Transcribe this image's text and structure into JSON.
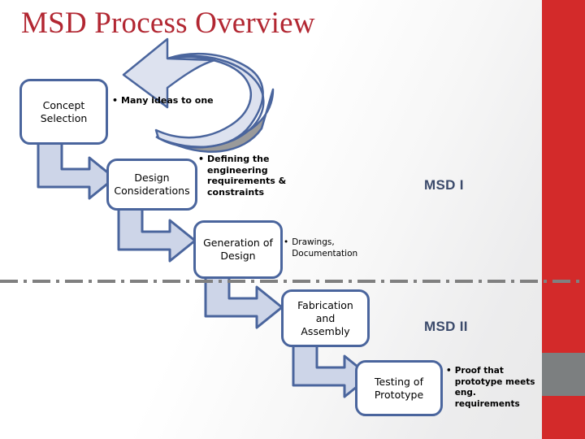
{
  "slide": {
    "title": "MSD Process Overview",
    "title_color": "#b22732",
    "accent_color": "#4a659d",
    "bar_red": "#d32a2a",
    "bar_gray": "#7c7f80"
  },
  "process": {
    "boxes": [
      {
        "id": "concept",
        "label": "Concept\nSelection"
      },
      {
        "id": "design",
        "label": "Design\nConsiderations"
      },
      {
        "id": "generation",
        "label": "Generation of\nDesign"
      },
      {
        "id": "fabrication",
        "label": "Fabrication\nand Assembly"
      },
      {
        "id": "testing",
        "label": "Testing of\nPrototype"
      }
    ],
    "box_labels": {
      "concept_line1": "Concept",
      "concept_line2": "Selection",
      "design_line1": "Design",
      "design_line2": "Considerations",
      "generation_line1": "Generation of",
      "generation_line2": "Design",
      "fabrication_line1": "Fabrication",
      "fabrication_line2": "and Assembly",
      "testing_line1": "Testing of",
      "testing_line2": "Prototype"
    }
  },
  "bullets": {
    "marker": "•",
    "ideas": "Many ideas to one",
    "defining": "Defining the engineering requirements & constraints",
    "drawings": "Drawings, Documentation",
    "proof": "Proof that prototype meets eng. requirements"
  },
  "phases": {
    "msd1": "MSD I",
    "msd2": "MSD II"
  }
}
